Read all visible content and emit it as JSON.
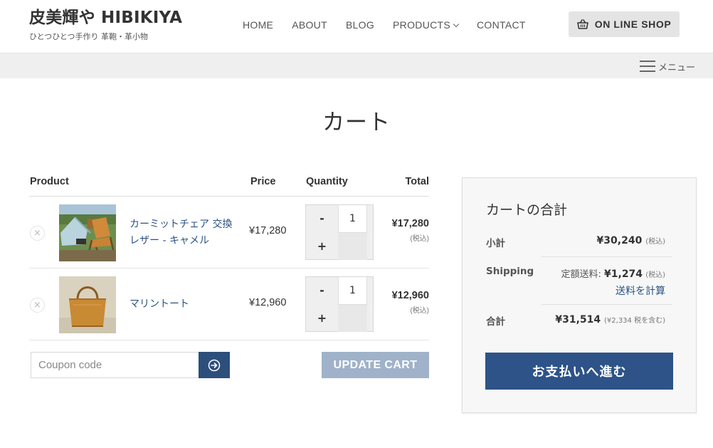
{
  "site": {
    "title": "皮美輝や HIBIKIYA",
    "tagline": "ひとつひとつ手作り 革鞄・革小物"
  },
  "nav": {
    "items": [
      {
        "label": "HOME"
      },
      {
        "label": "ABOUT"
      },
      {
        "label": "BLOG"
      },
      {
        "label": "PRODUCTS",
        "has_dropdown": true
      },
      {
        "label": "CONTACT"
      }
    ],
    "shop_button": "ON LINE SHOP",
    "menu_label": "メニュー"
  },
  "page": {
    "title": "カート"
  },
  "cart": {
    "headers": {
      "product": "Product",
      "price": "Price",
      "quantity": "Quantity",
      "total": "Total"
    },
    "items": [
      {
        "name": "カーミットチェア 交換レザー - キャメル",
        "price": "¥17,280",
        "quantity": "1",
        "total": "¥17,280",
        "tax_note": "(税込)",
        "remove": "×",
        "minus": "-",
        "plus": "+"
      },
      {
        "name": "マリントート",
        "price": "¥12,960",
        "quantity": "1",
        "total": "¥12,960",
        "tax_note": "(税込)",
        "remove": "×",
        "minus": "-",
        "plus": "+"
      }
    ],
    "coupon_placeholder": "Coupon code",
    "update_label": "UPDATE CART"
  },
  "totals": {
    "title": "カートの合計",
    "subtotal_label": "小計",
    "subtotal_value": "¥30,240",
    "subtotal_note": "(税込)",
    "shipping_label": "Shipping",
    "shipping_prefix": "定額送料:",
    "shipping_value": "¥1,274",
    "shipping_note": "(税込)",
    "shipping_calc": "送料を計算",
    "total_label": "合計",
    "total_value": "¥31,514",
    "total_note": "(¥2,334 税を含む)",
    "checkout_label": "お支払いへ進む"
  },
  "colors": {
    "link": "#2c5282",
    "primary_button": "#2d5388",
    "update_button": "#9fb2c9"
  }
}
